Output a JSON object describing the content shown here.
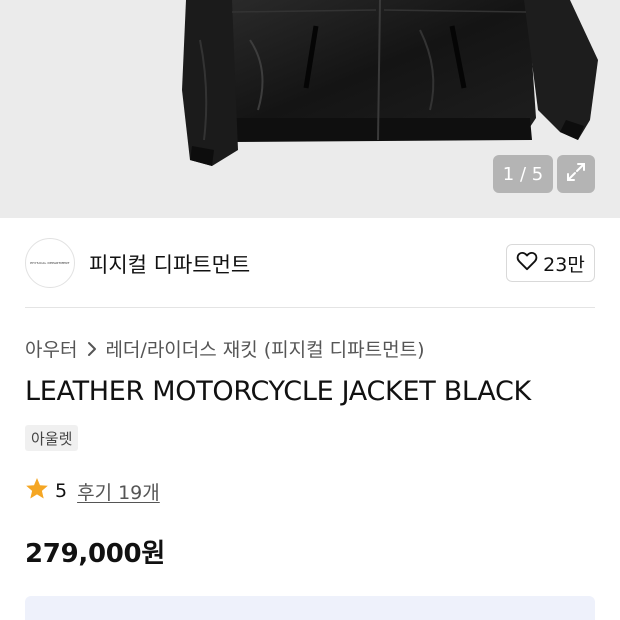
{
  "gallery": {
    "counter": "1 / 5",
    "expand_icon": "expand-icon"
  },
  "brand": {
    "logo_text": "PHYSICAL DEPARTMENT",
    "name": "피지컬 디파트먼트",
    "like_icon": "heart-outline-icon",
    "like_count": "23만"
  },
  "breadcrumb": {
    "category": "아우터",
    "separator_icon": "chevron-right-icon",
    "subcategory": "레더/라이더스 재킷 (피지컬 디파트먼트)"
  },
  "product": {
    "title": "LEATHER MOTORCYCLE JACKET BLACK",
    "badge": "아울렛",
    "rating_icon": "star-icon",
    "rating": "5",
    "reviews": "후기 19개",
    "price": "279,000원"
  },
  "colors": {
    "star": "#f5a623",
    "banner_bg": "#eef1fb"
  }
}
